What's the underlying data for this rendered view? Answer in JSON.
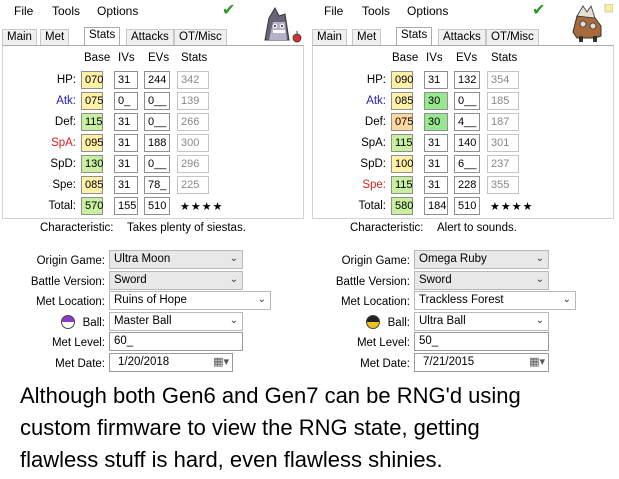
{
  "colors": {
    "green_check": "#2a9a2a",
    "base_bst": "#c8f0a0",
    "base_yellow": "#fff2a8",
    "base_orange": "#ffd8a0",
    "iv_green": "#98e890",
    "atk_blue": "#2020c0",
    "spa_red": "#d02020"
  },
  "menu": [
    "File",
    "Tools",
    "Options"
  ],
  "tabs": [
    "Main",
    "Met",
    "Stats",
    "Attacks",
    "OT/Misc"
  ],
  "column_headers": {
    "base": "Base",
    "ivs": "IVs",
    "evs": "EVs",
    "stats": "Stats"
  },
  "row_labels": [
    "HP:",
    "Atk:",
    "Def:",
    "SpA:",
    "SpD:",
    "Spe:",
    "Total:"
  ],
  "characteristic_label": "Characteristic:",
  "field_labels": {
    "origin": "Origin Game:",
    "battle": "Battle Version:",
    "location": "Met Location:",
    "ball": "Ball:",
    "level": "Met Level:",
    "date": "Met Date:"
  },
  "left": {
    "sprite": "mimikyu-icon",
    "stats": [
      {
        "base": "070",
        "iv": "31",
        "ev": "244",
        "stat": "342",
        "base_color": "#fff2a8"
      },
      {
        "base": "075",
        "iv": "0_",
        "ev": "0__",
        "stat": "139",
        "base_color": "#fff2a8"
      },
      {
        "base": "115",
        "iv": "31",
        "ev": "0__",
        "stat": "266",
        "base_color": "#c8f0a0"
      },
      {
        "base": "095",
        "iv": "31",
        "ev": "188",
        "stat": "300",
        "base_color": "#fff2a8"
      },
      {
        "base": "130",
        "iv": "31",
        "ev": "0__",
        "stat": "296",
        "base_color": "#c8f0a0"
      },
      {
        "base": "085",
        "iv": "31",
        "ev": "78_",
        "stat": "225",
        "base_color": "#fff2a8"
      }
    ],
    "total": {
      "base": "570",
      "iv": "155",
      "ev": "510",
      "stars": "★★★★"
    },
    "characteristic": "Takes plenty of siestas.",
    "origin_game": "Ultra Moon",
    "battle_version": "Sword",
    "met_location": "Ruins of Hope",
    "ball": "Master Ball",
    "met_level": "60_",
    "met_date": "1/20/2018"
  },
  "right": {
    "sprite": "entei-icon",
    "stats": [
      {
        "base": "090",
        "iv": "31",
        "ev": "132",
        "stat": "354",
        "base_color": "#fff2a8"
      },
      {
        "base": "085",
        "iv": "30",
        "ev": "0__",
        "stat": "185",
        "base_color": "#fff2a8",
        "iv_color": "#98e890"
      },
      {
        "base": "075",
        "iv": "30",
        "ev": "4__",
        "stat": "187",
        "base_color": "#ffd8a0",
        "iv_color": "#98e890"
      },
      {
        "base": "115",
        "iv": "31",
        "ev": "140",
        "stat": "301",
        "base_color": "#c8f0a0"
      },
      {
        "base": "100",
        "iv": "31",
        "ev": "6__",
        "stat": "237",
        "base_color": "#fff2a8"
      },
      {
        "base": "115",
        "iv": "31",
        "ev": "228",
        "stat": "355",
        "base_color": "#c8f0a0"
      }
    ],
    "total": {
      "base": "580",
      "iv": "184",
      "ev": "510",
      "stars": "★★★★"
    },
    "characteristic": "Alert to sounds.",
    "origin_game": "Omega Ruby",
    "battle_version": "Sword",
    "met_location": "Trackless Forest",
    "ball": "Ultra Ball",
    "met_level": "50_",
    "met_date": "7/21/2015"
  },
  "caption_lines": [
    "Although both Gen6 and Gen7 can be RNG'd using",
    "custom firmware to view the RNG state, getting",
    "flawless stuff is hard, even flawless shinies."
  ]
}
